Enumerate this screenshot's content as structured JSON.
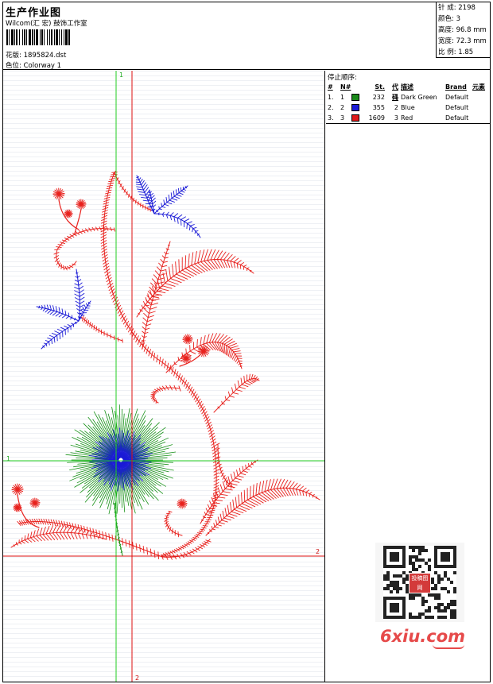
{
  "header": {
    "title": "生产作业图",
    "subtitle": "Wilcom(汇 宏) 鼓饰工作室",
    "file_label": "花版: 1895824.dst",
    "colorway_label": "色位: Colorway 1"
  },
  "stats": {
    "stitches": "针 成: 2198",
    "colors": "颜色: 3",
    "height": "高度: 96.8 mm",
    "width": "宽度: 72.3 mm",
    "scale": "比 例: 1.85"
  },
  "guides": {
    "top_label": "1",
    "left_label": "1",
    "right_label": "2",
    "bottom_label": "2"
  },
  "stop_sequence": {
    "title": "停止顺序:",
    "columns": [
      "#",
      "N#",
      "St.",
      "代码",
      "描述",
      "Brand",
      "元素"
    ],
    "rows": [
      {
        "num": "1.",
        "n": "1",
        "color": "#1b8a1b",
        "stitches": "232",
        "code": "1",
        "desc": "Dark Green",
        "brand": "Default"
      },
      {
        "num": "2.",
        "n": "2",
        "color": "#1e1ed8",
        "stitches": "355",
        "code": "2",
        "desc": "Blue",
        "brand": "Default"
      },
      {
        "num": "3.",
        "n": "3",
        "color": "#e01b1b",
        "stitches": "1609",
        "code": "3",
        "desc": "Red",
        "brand": "Default"
      }
    ]
  },
  "colors": {
    "green_guide": "#22cc22",
    "red_guide": "#dd1111",
    "thread_red": "#e8221e",
    "thread_blue": "#1a1ad6",
    "thread_green": "#169116"
  },
  "watermark": {
    "text": "6xiu.com",
    "badge": "投稿图网"
  }
}
